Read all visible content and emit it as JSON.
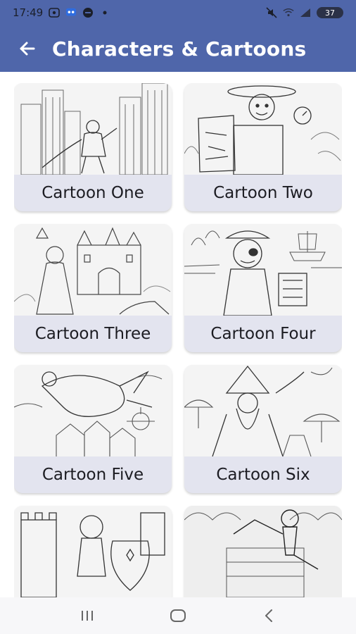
{
  "status": {
    "time": "17:49",
    "battery": "37",
    "left_icons": [
      "sim-icon",
      "chat-icon",
      "record-icon",
      "dot-icon"
    ],
    "right_icons": [
      "mute-icon",
      "wifi-icon",
      "signal-icon"
    ]
  },
  "header": {
    "title": "Characters & Cartoons",
    "background_color": "#4f66aa"
  },
  "cards": [
    {
      "label": "Cartoon One",
      "image": "superhero-city"
    },
    {
      "label": "Cartoon Two",
      "image": "explorer-map"
    },
    {
      "label": "Cartoon Three",
      "image": "princess-castle"
    },
    {
      "label": "Cartoon Four",
      "image": "pirate-ship"
    },
    {
      "label": "Cartoon Five",
      "image": "dragon-castle"
    },
    {
      "label": "Cartoon Six",
      "image": "wizard-mushrooms"
    },
    {
      "label": "",
      "image": "knight-castle"
    },
    {
      "label": "",
      "image": "martial-artist"
    }
  ],
  "navigation": {
    "buttons": [
      "recent-apps",
      "home",
      "back"
    ]
  }
}
